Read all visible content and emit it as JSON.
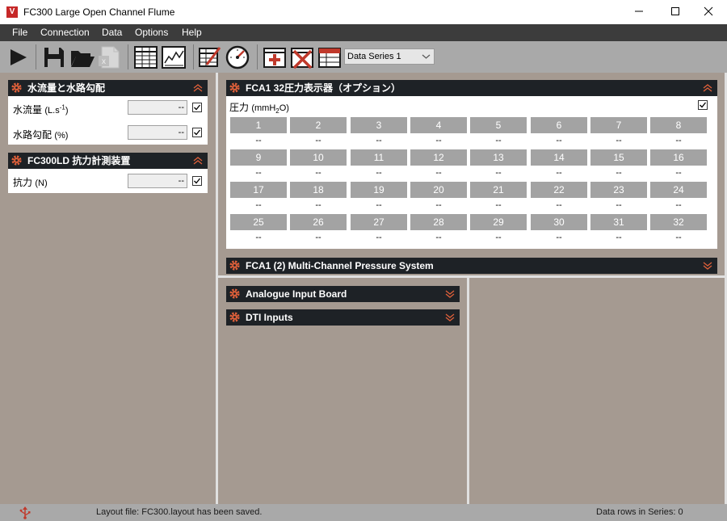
{
  "window": {
    "title": "FC300 Large Open Channel Flume",
    "icon_letter": "V",
    "minimize": "—",
    "maximize": "☐",
    "close": "✕"
  },
  "menu": [
    "File",
    "Connection",
    "Data",
    "Options",
    "Help"
  ],
  "toolbar": {
    "series_selected": "Data Series 1"
  },
  "panels": {
    "flow": {
      "title": "水流量と水路勾配",
      "rows": [
        {
          "label": "水流量",
          "unit_pre": "(L.s",
          "unit_sup": "-1",
          "unit_post": ")",
          "value": "--"
        },
        {
          "label": "水路勾配",
          "unit": "(%)",
          "value": "--"
        }
      ]
    },
    "drag": {
      "title": "FC300LD  抗力計測装置",
      "rows": [
        {
          "label": "抗力",
          "unit": "(N)",
          "value": "--"
        }
      ]
    },
    "pressure": {
      "title": "FCA1   32圧力表示器（オプション）",
      "label": "圧力",
      "unit_pre": "(mmH",
      "unit_sub": "2",
      "unit_post": "O)",
      "channels": [
        "1",
        "2",
        "3",
        "4",
        "5",
        "6",
        "7",
        "8",
        "9",
        "10",
        "11",
        "12",
        "13",
        "14",
        "15",
        "16",
        "17",
        "18",
        "19",
        "20",
        "21",
        "22",
        "23",
        "24",
        "25",
        "26",
        "27",
        "28",
        "29",
        "30",
        "31",
        "32"
      ],
      "values": [
        "--",
        "--",
        "--",
        "--",
        "--",
        "--",
        "--",
        "--",
        "--",
        "--",
        "--",
        "--",
        "--",
        "--",
        "--",
        "--",
        "--",
        "--",
        "--",
        "--",
        "--",
        "--",
        "--",
        "--",
        "--",
        "--",
        "--",
        "--",
        "--",
        "--",
        "--",
        "--"
      ]
    },
    "multichannel": {
      "title": "FCA1 (2) Multi-Channel Pressure System"
    },
    "analogue": {
      "title": "Analogue Input Board"
    },
    "dti": {
      "title": "DTI Inputs"
    }
  },
  "status": {
    "layout_message": "Layout file: FC300.layout has been saved.",
    "rows_message": "Data rows in Series: 0"
  },
  "colors": {
    "header_bg": "#1e2226",
    "gear_accent": "#e0603a",
    "workspace_bg": "#a59a91",
    "channel_cell": "#a3a3a3"
  }
}
